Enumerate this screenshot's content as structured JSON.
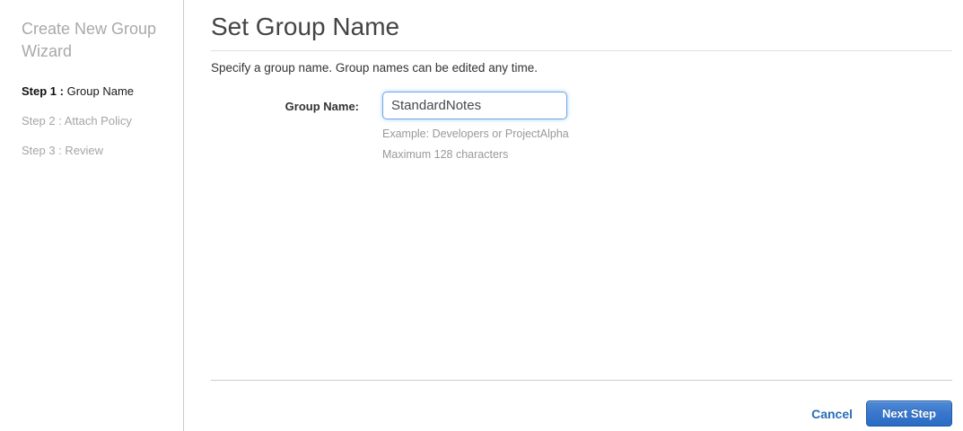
{
  "sidebar": {
    "title": "Create New Group Wizard",
    "steps": [
      {
        "prefix": "Step 1 :",
        "label": " Group Name"
      },
      {
        "prefix": "Step 2 :",
        "label": " Attach Policy"
      },
      {
        "prefix": "Step 3 :",
        "label": " Review"
      }
    ]
  },
  "main": {
    "title": "Set Group Name",
    "description": "Specify a group name. Group names can be edited any time.",
    "form": {
      "label": "Group Name:",
      "value": "StandardNotes",
      "hint_example": "Example: Developers or ProjectAlpha",
      "hint_max": "Maximum 128 characters"
    },
    "footer": {
      "cancel_label": "Cancel",
      "next_label": "Next Step"
    }
  },
  "colors": {
    "accent_blue": "#2a6db5",
    "button_gradient_top": "#4f8ad6",
    "button_gradient_bottom": "#2b6cc4",
    "input_focus_border": "#72a7e2",
    "divider_gray": "#cccccc"
  }
}
